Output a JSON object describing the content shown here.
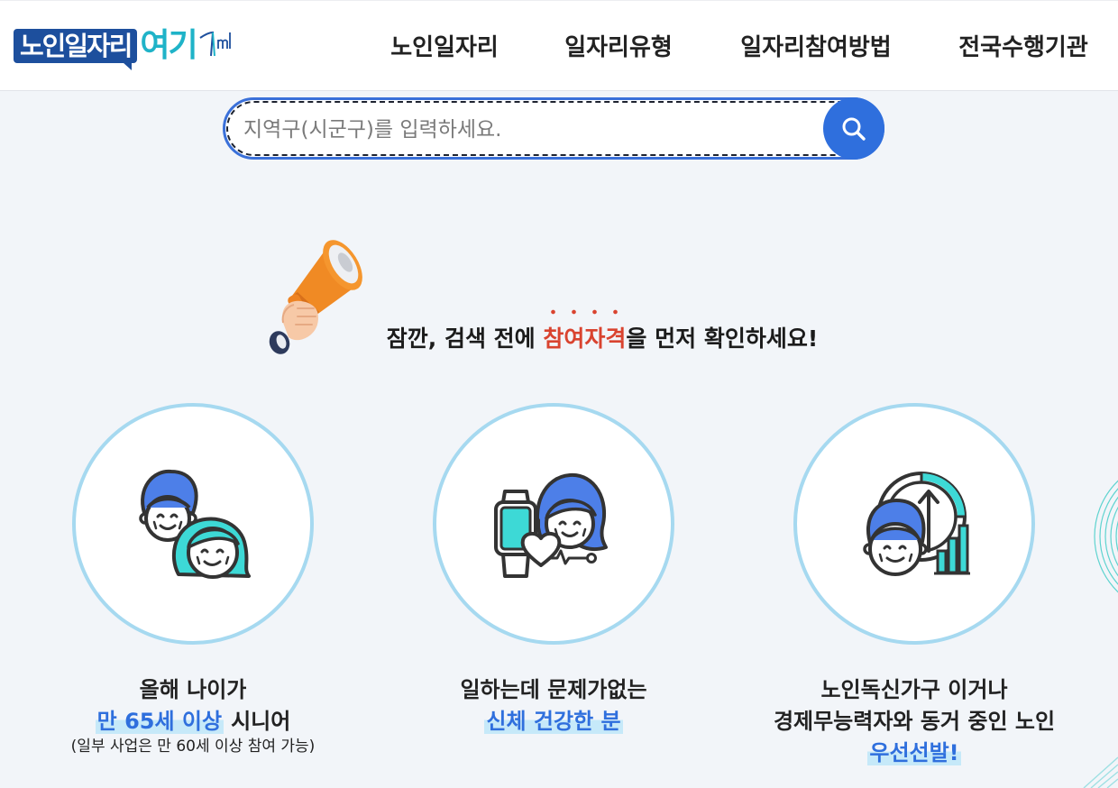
{
  "header": {
    "logo": {
      "main": "노인일자리",
      "accent": "여기",
      "mark_icon": "logo-mark-icon"
    },
    "nav": [
      {
        "label": "노인일자리"
      },
      {
        "label": "일자리유형"
      },
      {
        "label": "일자리참여방법"
      },
      {
        "label": "전국수행기관"
      }
    ]
  },
  "search": {
    "placeholder": "지역구(시군구)를 입력하세요.",
    "value": "",
    "button_icon": "search-icon"
  },
  "notice": {
    "icon": "megaphone-icon",
    "before": "잠깐, 검색 전에 ",
    "highlight": "참여자격",
    "after": "을 먼저 확인하세요!"
  },
  "criteria": [
    {
      "icon": "senior-couple-icon",
      "line1": "올해 나이가",
      "line2_highlight": "만 65세 이상",
      "line2_rest": "시니어",
      "note": "(일부 사업은 만 60세 이상 참여 가능)"
    },
    {
      "icon": "smartwatch-health-icon",
      "line1": "일하는데 문제가없는",
      "line2_highlight": "신체 건강한 분"
    },
    {
      "icon": "senior-economy-chart-icon",
      "line1": "노인독신가구 이거나",
      "line2": "경제무능력자와 동거 중인 노인",
      "line3_highlight": "우선선발!"
    }
  ],
  "colors": {
    "logo_navy": "#1d4f9d",
    "logo_teal": "#1fb3c8",
    "accent_blue": "#2f6fdd",
    "notice_red": "#d9432f",
    "circle_border": "#a6d9f0",
    "highlight_bg": "#c6e9f9",
    "icon_teal": "#3dd9d6",
    "icon_blue": "#4d7fe8",
    "page_bg": "#f2f5f9"
  }
}
